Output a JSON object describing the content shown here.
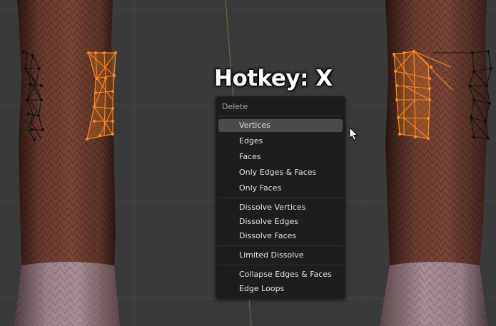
{
  "hotkey_overlay": {
    "text": "Hotkey: X"
  },
  "menu": {
    "title": "Delete",
    "groups": [
      [
        "Vertices",
        "Edges",
        "Faces",
        "Only Edges & Faces",
        "Only Faces"
      ],
      [
        "Dissolve Vertices",
        "Dissolve Edges",
        "Dissolve Faces"
      ],
      [
        "Limited Dissolve"
      ],
      [
        "Collapse Edges & Faces",
        "Edge Loops"
      ]
    ],
    "highlighted": "Vertices"
  },
  "colors": {
    "selection": "#ff8a1f",
    "menu_background": "#1d1d1d",
    "menu_highlight": "#4b4b4b",
    "viewport_grid": "#3a3a3a"
  },
  "icons": [
    "mouse-pointer-icon"
  ]
}
